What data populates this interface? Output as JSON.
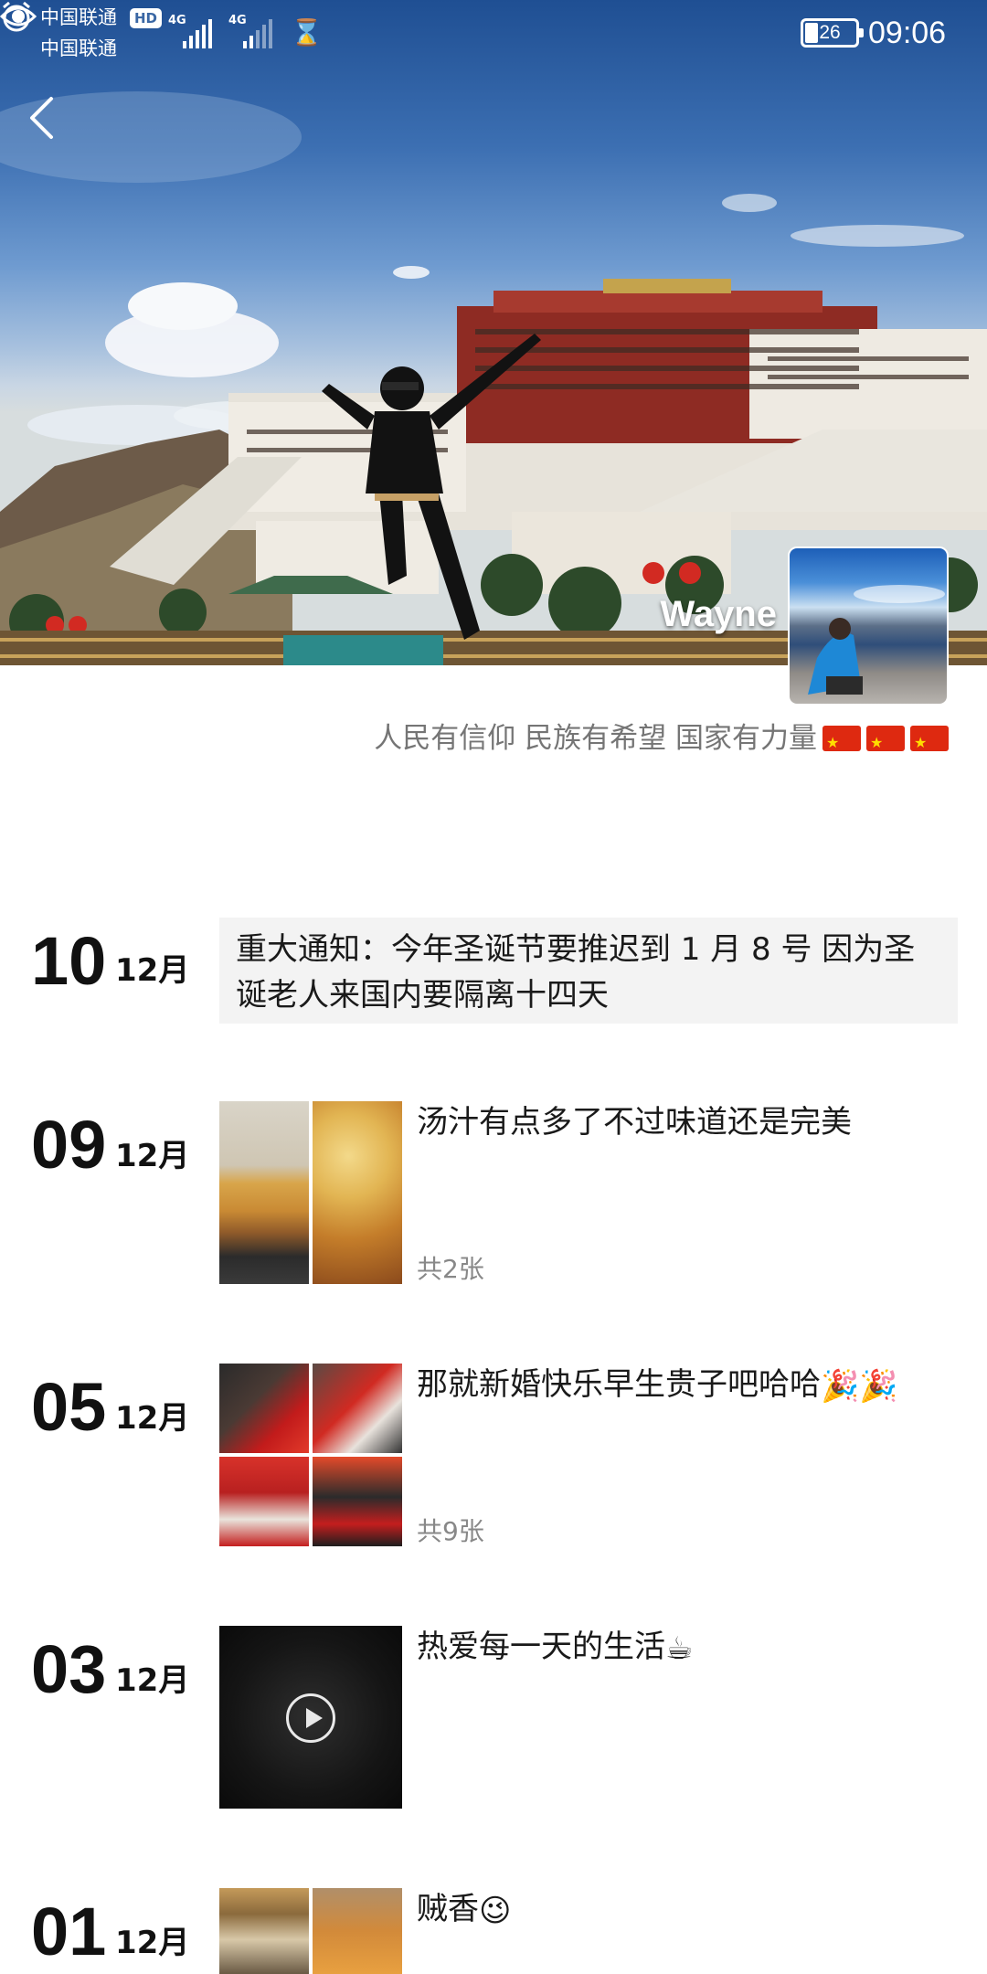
{
  "status_bar": {
    "carrier_1": "中国联通",
    "carrier_2": "中国联通",
    "hd_label": "HD",
    "network_1": "4G",
    "network_2": "4G",
    "battery_level": "26",
    "time": "09:06"
  },
  "profile": {
    "username": "Wayne",
    "signature": "人民有信仰 民族有希望 国家有力量",
    "signature_flag_count": 3
  },
  "posts": [
    {
      "day": "10",
      "month": "12月",
      "text": "重大通知：今年圣诞节要推迟到 1 月 8 号 因为圣诞老人来国内要隔离十四天",
      "type": "notice"
    },
    {
      "day": "09",
      "month": "12月",
      "text": "汤汁有点多了不过味道还是完美",
      "photo_count": "共2张",
      "type": "photos-2"
    },
    {
      "day": "05",
      "month": "12月",
      "text": "那就新婚快乐早生贵子吧哈哈",
      "emoji": "🎉🎉",
      "photo_count": "共9张",
      "type": "photos-4"
    },
    {
      "day": "03",
      "month": "12月",
      "text": "热爱每一天的生活",
      "emoji": "☕",
      "type": "video"
    },
    {
      "day": "01",
      "month": "12月",
      "text": "贼香",
      "emoji": "😉",
      "type": "photos-2"
    }
  ]
}
